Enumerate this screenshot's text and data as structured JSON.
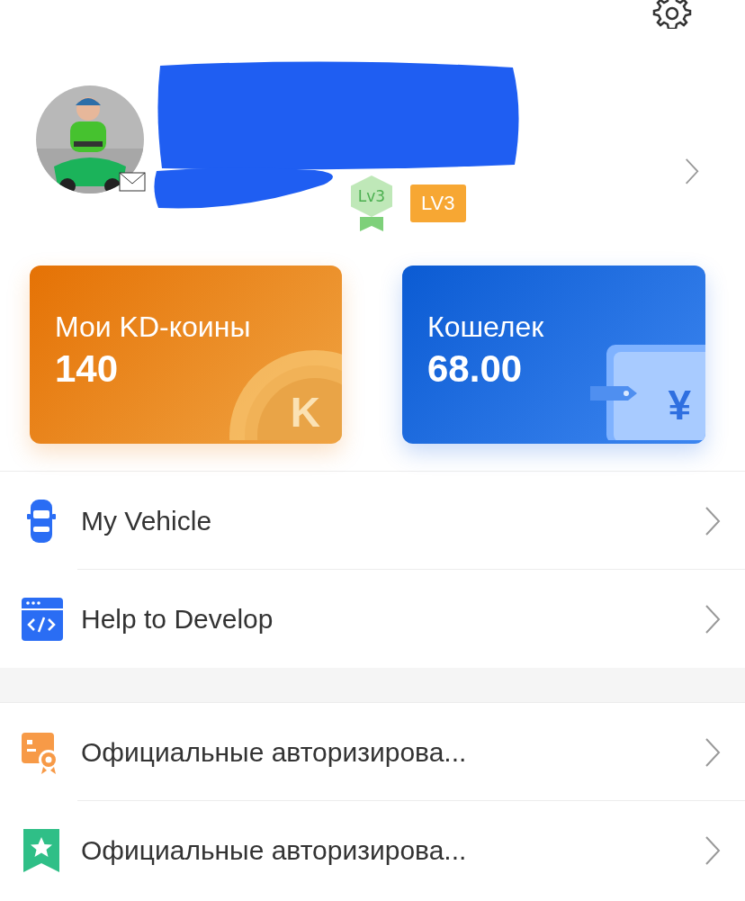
{
  "profile": {
    "badges": [
      {
        "kind": "hexagon",
        "label": "Lv3"
      },
      {
        "kind": "tag",
        "label": "LV3"
      }
    ]
  },
  "cards": [
    {
      "kind": "coins",
      "title": "Мои KD-коины",
      "value": "140",
      "symbol": "K"
    },
    {
      "kind": "wallet",
      "title": "Кошелек",
      "value": "68.00",
      "symbol": "¥"
    }
  ],
  "sections": [
    {
      "items": [
        {
          "kind": "vehicle",
          "label": "My Vehicle"
        },
        {
          "kind": "develop",
          "label": "Help to Develop"
        }
      ]
    },
    {
      "items": [
        {
          "kind": "official",
          "label": "Официальные авторизирова..."
        },
        {
          "kind": "favorite",
          "label": "Официальные авторизирова..."
        }
      ]
    }
  ]
}
